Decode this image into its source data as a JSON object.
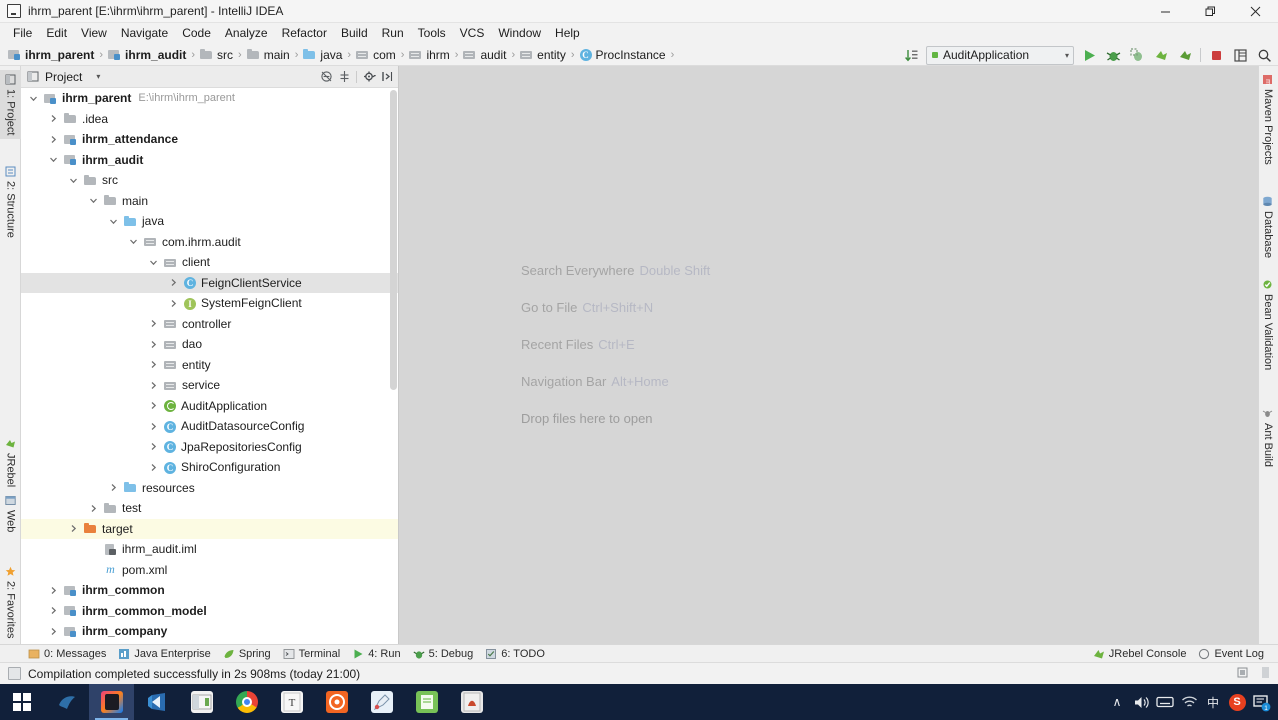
{
  "window": {
    "title": "ihrm_parent [E:\\ihrm\\ihrm_parent] - IntelliJ IDEA",
    "app_icon": "intellij-idea-logo",
    "minimize_label": "−",
    "maximize_label": "❐",
    "close_label": "✕"
  },
  "menubar": {
    "items": [
      {
        "label": "File",
        "mnemonic": "F"
      },
      {
        "label": "Edit",
        "mnemonic": "E"
      },
      {
        "label": "View",
        "mnemonic": "V"
      },
      {
        "label": "Navigate",
        "mnemonic": "N"
      },
      {
        "label": "Code",
        "mnemonic": "C"
      },
      {
        "label": "Analyze",
        "mnemonic": ""
      },
      {
        "label": "Refactor",
        "mnemonic": "R"
      },
      {
        "label": "Build",
        "mnemonic": "B"
      },
      {
        "label": "Run",
        "mnemonic": "u"
      },
      {
        "label": "Tools",
        "mnemonic": "T"
      },
      {
        "label": "VCS",
        "mnemonic": "S"
      },
      {
        "label": "Window",
        "mnemonic": "W"
      },
      {
        "label": "Help",
        "mnemonic": "H"
      }
    ]
  },
  "breadcrumb": {
    "items": [
      {
        "label": "ihrm_parent",
        "icon": "module-icon",
        "bold": true
      },
      {
        "label": "ihrm_audit",
        "icon": "module-icon",
        "bold": true
      },
      {
        "label": "src",
        "icon": "folder-icon",
        "bold": false
      },
      {
        "label": "main",
        "icon": "folder-icon",
        "bold": false
      },
      {
        "label": "java",
        "icon": "source-folder-icon",
        "bold": false
      },
      {
        "label": "com",
        "icon": "package-icon",
        "bold": false
      },
      {
        "label": "ihrm",
        "icon": "package-icon",
        "bold": false
      },
      {
        "label": "audit",
        "icon": "package-icon",
        "bold": false
      },
      {
        "label": "entity",
        "icon": "package-icon",
        "bold": false
      },
      {
        "label": "ProcInstance",
        "icon": "class-icon",
        "bold": false
      }
    ],
    "separator": "›"
  },
  "toolbar": {
    "sort_icon": "sort-alphabetically-icon",
    "run_config": {
      "label": "AuditApplication",
      "status_color": "#62b543",
      "dropdown_arrow": "▾"
    },
    "buttons": [
      {
        "name": "run-button",
        "icon": "run-triangle-icon"
      },
      {
        "name": "debug-button",
        "icon": "debug-bug-icon"
      },
      {
        "name": "run-coverage-button",
        "icon": "coverage-icon"
      },
      {
        "name": "jrebel-run-button",
        "icon": "jrebel-run-icon"
      },
      {
        "name": "jrebel-debug-button",
        "icon": "jrebel-debug-icon"
      },
      {
        "name": "stop-button",
        "icon": "stop-square-icon"
      },
      {
        "name": "layout-button",
        "icon": "window-layout-icon"
      },
      {
        "name": "search-button",
        "icon": "search-icon"
      }
    ]
  },
  "left_strip": {
    "top_tabs": [
      {
        "label": "1: Project",
        "mnemonic": "1",
        "icon": "project-icon",
        "active": true
      },
      {
        "label": "2: Structure",
        "mnemonic": "7",
        "icon": "structure-icon",
        "active": false
      }
    ],
    "bottom_tabs": [
      {
        "label": "JRebel",
        "icon": "jrebel-icon"
      },
      {
        "label": "Web",
        "icon": "web-icon"
      },
      {
        "label": "2: Favorites",
        "mnemonic": "2",
        "icon": "favorites-star-icon"
      }
    ]
  },
  "right_strip": {
    "tabs": [
      {
        "label": "Maven Projects",
        "icon": "maven-icon"
      },
      {
        "label": "Database",
        "icon": "database-icon"
      },
      {
        "label": "Bean Validation",
        "icon": "bean-validation-icon"
      },
      {
        "label": "Ant Build",
        "icon": "ant-build-icon"
      }
    ]
  },
  "project_panel": {
    "title": "Project",
    "title_icon": "project-view-icon",
    "dropdown_arrow": "▾",
    "tools": [
      {
        "name": "collapse-all-button",
        "icon": "collapse-all-icon"
      },
      {
        "name": "scroll-from-source-button",
        "icon": "target-crosshair-icon"
      },
      {
        "name": "settings-button",
        "icon": "gear-icon"
      },
      {
        "name": "hide-panel-button",
        "icon": "hide-panel-icon"
      }
    ],
    "tree": [
      {
        "label": "ihrm_parent",
        "path": "E:\\ihrm\\ihrm_parent",
        "indent": 0,
        "twist": "expanded",
        "icon": "module-icon",
        "bold": true,
        "state": "normal"
      },
      {
        "label": ".idea",
        "path": "",
        "indent": 1,
        "twist": "collapsed",
        "icon": "folder-icon",
        "bold": false,
        "state": "normal"
      },
      {
        "label": "ihrm_attendance",
        "path": "",
        "indent": 1,
        "twist": "collapsed",
        "icon": "module-icon",
        "bold": true,
        "state": "normal"
      },
      {
        "label": "ihrm_audit",
        "path": "",
        "indent": 1,
        "twist": "expanded",
        "icon": "module-icon",
        "bold": true,
        "state": "normal"
      },
      {
        "label": "src",
        "path": "",
        "indent": 2,
        "twist": "expanded",
        "icon": "folder-icon",
        "bold": false,
        "state": "normal"
      },
      {
        "label": "main",
        "path": "",
        "indent": 3,
        "twist": "expanded",
        "icon": "folder-icon",
        "bold": false,
        "state": "normal"
      },
      {
        "label": "java",
        "path": "",
        "indent": 4,
        "twist": "expanded",
        "icon": "source-folder-icon",
        "bold": false,
        "state": "normal"
      },
      {
        "label": "com.ihrm.audit",
        "path": "",
        "indent": 5,
        "twist": "expanded",
        "icon": "package-icon",
        "bold": false,
        "state": "normal"
      },
      {
        "label": "client",
        "path": "",
        "indent": 6,
        "twist": "expanded",
        "icon": "package-icon",
        "bold": false,
        "state": "normal"
      },
      {
        "label": "FeignClientService",
        "path": "",
        "indent": 7,
        "twist": "collapsed",
        "icon": "class-icon",
        "bold": false,
        "state": "selected"
      },
      {
        "label": "SystemFeignClient",
        "path": "",
        "indent": 7,
        "twist": "collapsed",
        "icon": "interface-icon",
        "bold": false,
        "state": "normal"
      },
      {
        "label": "controller",
        "path": "",
        "indent": 6,
        "twist": "collapsed",
        "icon": "package-icon",
        "bold": false,
        "state": "normal"
      },
      {
        "label": "dao",
        "path": "",
        "indent": 6,
        "twist": "collapsed",
        "icon": "package-icon",
        "bold": false,
        "state": "normal"
      },
      {
        "label": "entity",
        "path": "",
        "indent": 6,
        "twist": "collapsed",
        "icon": "package-icon",
        "bold": false,
        "state": "normal"
      },
      {
        "label": "service",
        "path": "",
        "indent": 6,
        "twist": "collapsed",
        "icon": "package-icon",
        "bold": false,
        "state": "normal"
      },
      {
        "label": "AuditApplication",
        "path": "",
        "indent": 6,
        "twist": "collapsed",
        "icon": "spring-boot-icon",
        "bold": false,
        "state": "normal"
      },
      {
        "label": "AuditDatasourceConfig",
        "path": "",
        "indent": 6,
        "twist": "collapsed",
        "icon": "class-icon",
        "bold": false,
        "state": "normal"
      },
      {
        "label": "JpaRepositoriesConfig",
        "path": "",
        "indent": 6,
        "twist": "collapsed",
        "icon": "class-icon",
        "bold": false,
        "state": "normal"
      },
      {
        "label": "ShiroConfiguration",
        "path": "",
        "indent": 6,
        "twist": "collapsed",
        "icon": "class-icon",
        "bold": false,
        "state": "normal"
      },
      {
        "label": "resources",
        "path": "",
        "indent": 4,
        "twist": "collapsed",
        "icon": "resource-folder-icon",
        "bold": false,
        "state": "normal"
      },
      {
        "label": "test",
        "path": "",
        "indent": 3,
        "twist": "collapsed",
        "icon": "folder-icon",
        "bold": false,
        "state": "normal"
      },
      {
        "label": "target",
        "path": "",
        "indent": 2,
        "twist": "collapsed",
        "icon": "excluded-folder-icon",
        "bold": false,
        "state": "excluded"
      },
      {
        "label": "ihrm_audit.iml",
        "path": "",
        "indent": 3,
        "twist": "none",
        "icon": "iml-file-icon",
        "bold": false,
        "state": "normal"
      },
      {
        "label": "pom.xml",
        "path": "",
        "indent": 3,
        "twist": "none",
        "icon": "maven-pom-icon",
        "bold": false,
        "state": "normal"
      },
      {
        "label": "ihrm_common",
        "path": "",
        "indent": 1,
        "twist": "collapsed",
        "icon": "module-icon",
        "bold": true,
        "state": "normal"
      },
      {
        "label": "ihrm_common_model",
        "path": "",
        "indent": 1,
        "twist": "collapsed",
        "icon": "module-icon",
        "bold": true,
        "state": "normal"
      },
      {
        "label": "ihrm_company",
        "path": "",
        "indent": 1,
        "twist": "collapsed",
        "icon": "module-icon",
        "bold": true,
        "state": "normal"
      }
    ]
  },
  "editor": {
    "hints": [
      {
        "action": "Search Everywhere",
        "key": "Double Shift"
      },
      {
        "action": "Go to File",
        "key": "Ctrl+Shift+N"
      },
      {
        "action": "Recent Files",
        "key": "Ctrl+E"
      },
      {
        "action": "Navigation Bar",
        "key": "Alt+Home"
      },
      {
        "action": "Drop files here to open",
        "key": ""
      }
    ]
  },
  "bottom_bar": {
    "tabs": [
      {
        "label": "0: Messages",
        "mnemonic": "0",
        "icon": "messages-icon"
      },
      {
        "label": "Java Enterprise",
        "mnemonic": "",
        "icon": "java-enterprise-icon"
      },
      {
        "label": "Spring",
        "mnemonic": "",
        "icon": "spring-leaf-icon"
      },
      {
        "label": "Terminal",
        "mnemonic": "",
        "icon": "terminal-icon"
      },
      {
        "label": "4: Run",
        "mnemonic": "4",
        "icon": "run-triangle-icon"
      },
      {
        "label": "5: Debug",
        "mnemonic": "5",
        "icon": "debug-bug-icon"
      },
      {
        "label": "6: TODO",
        "mnemonic": "6",
        "icon": "todo-icon"
      }
    ],
    "right_tabs": [
      {
        "label": "JRebel Console",
        "icon": "jrebel-icon"
      },
      {
        "label": "Event Log",
        "icon": "event-log-icon"
      }
    ]
  },
  "status_bar": {
    "message": "Compilation completed successfully in 2s 908ms (today 21:00)",
    "icon": "build-status-icon",
    "right_icons": [
      {
        "name": "background-tasks-icon"
      },
      {
        "name": "memory-indicator-icon"
      }
    ]
  },
  "taskbar": {
    "start_label": "start-button",
    "apps": [
      {
        "name": "navicat-icon",
        "color": "#11203a",
        "active": false
      },
      {
        "name": "intellij-idea-icon",
        "color": "#ed3f7d",
        "active": true
      },
      {
        "name": "visual-studio-icon",
        "color": "#1f4e8c",
        "active": false
      },
      {
        "name": "file-explorer-icon",
        "color": "#f2f2f2",
        "active": false
      },
      {
        "name": "google-chrome-icon",
        "color": "#4285f4",
        "active": false
      },
      {
        "name": "typora-icon",
        "color": "#f5f5f5",
        "active": false
      },
      {
        "name": "xmind-icon",
        "color": "#f26522",
        "active": false
      },
      {
        "name": "paint-icon",
        "color": "#e8f0f8",
        "active": false
      },
      {
        "name": "notepad-icon",
        "color": "#78c257",
        "active": false
      },
      {
        "name": "jmeter-icon",
        "color": "#e8e8e8",
        "active": false
      }
    ],
    "tray": [
      {
        "name": "show-hidden-icons-chevron",
        "glyph": "∧"
      },
      {
        "name": "volume-icon",
        "glyph": "🔊"
      },
      {
        "name": "keyboard-icon",
        "glyph": "⌨"
      },
      {
        "name": "network-wifi-icon",
        "glyph": "◠"
      },
      {
        "name": "ime-chinese-icon",
        "glyph": "中"
      },
      {
        "name": "sogou-input-icon",
        "glyph": "S"
      },
      {
        "name": "notifications-icon",
        "glyph": "❐"
      }
    ]
  }
}
